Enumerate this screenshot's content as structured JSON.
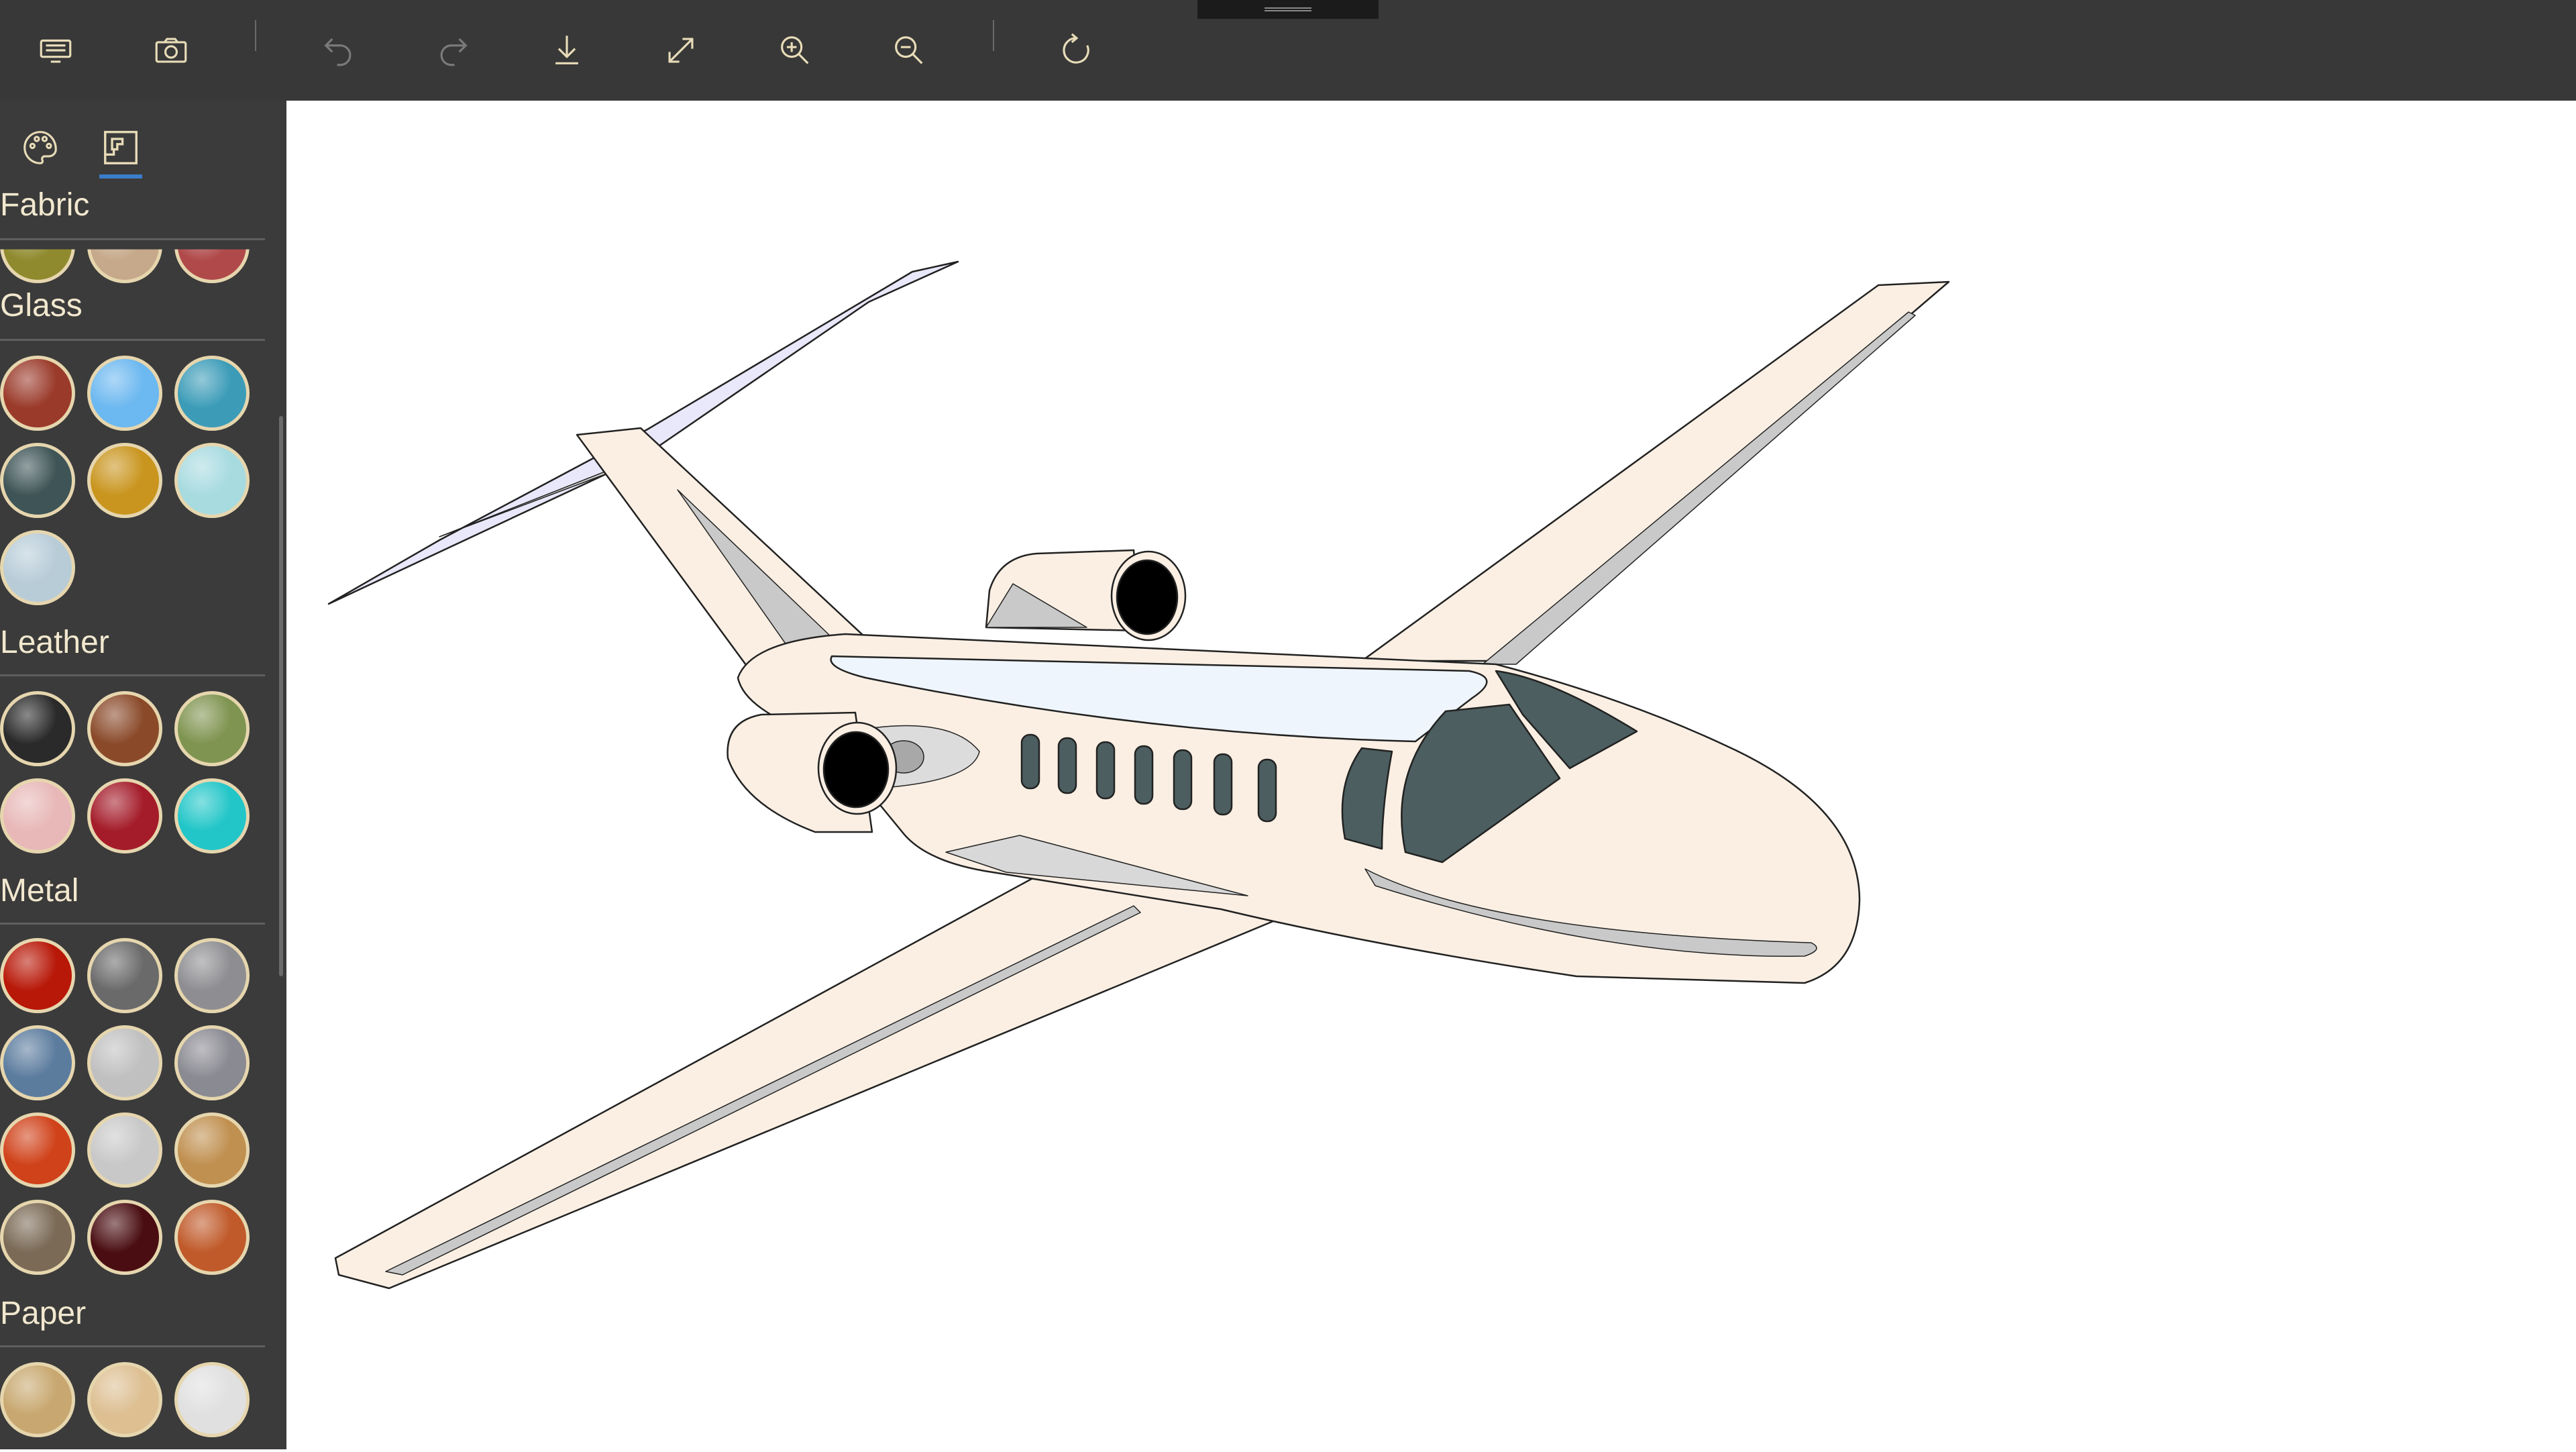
{
  "toolbar": {
    "buttons": [
      {
        "name": "keyboard-icon"
      },
      {
        "name": "camera-icon"
      },
      {
        "name": "undo-icon"
      },
      {
        "name": "redo-icon"
      },
      {
        "name": "download-icon"
      },
      {
        "name": "fullscreen-icon"
      },
      {
        "name": "zoom-in-icon"
      },
      {
        "name": "zoom-out-icon"
      },
      {
        "name": "refresh-icon"
      }
    ]
  },
  "sidebar": {
    "tabs": [
      {
        "icon": "palette-icon",
        "active": false
      },
      {
        "icon": "texture-icon",
        "active": true
      }
    ],
    "categories": [
      {
        "label": "Fabric",
        "swatches": [
          "#8f8a2e",
          "#c6a98a",
          "#b04a4a"
        ]
      },
      {
        "label": "Glass",
        "swatches": [
          "#9a3a2a",
          "#6cb8f0",
          "#3c9cb8",
          "#3e5456",
          "#c9951e",
          "#a8dbe0",
          "#b8ccd8"
        ]
      },
      {
        "label": "Leather",
        "swatches": [
          "#2a2a2a",
          "#8a4a2a",
          "#7f9450",
          "#e8b8b8",
          "#a41c2a",
          "#22c6c8"
        ]
      },
      {
        "label": "Metal",
        "swatches": [
          "#b81808",
          "#6a6a6a",
          "#8e8e92",
          "#5c7c9e",
          "#c0c0c0",
          "#8a8a92",
          "#d0421a",
          "#c8c8c8",
          "#c09050",
          "#7a6a56",
          "#4a0e12",
          "#c05a2a"
        ]
      },
      {
        "label": "Paper",
        "swatches": [
          "#c8a870",
          "#ddbf92",
          "#e0e0e0"
        ]
      }
    ]
  },
  "colors": {
    "toolbar_bg": "#383838",
    "sidebar_bg": "#3b3b3b",
    "label": "#f2e8cf",
    "accent": "#3a7ecb",
    "fuselage": "#fbefe3",
    "window": "#eef5fc",
    "cockpit_glass": "#4c5e60",
    "engine_intake": "#000000"
  }
}
